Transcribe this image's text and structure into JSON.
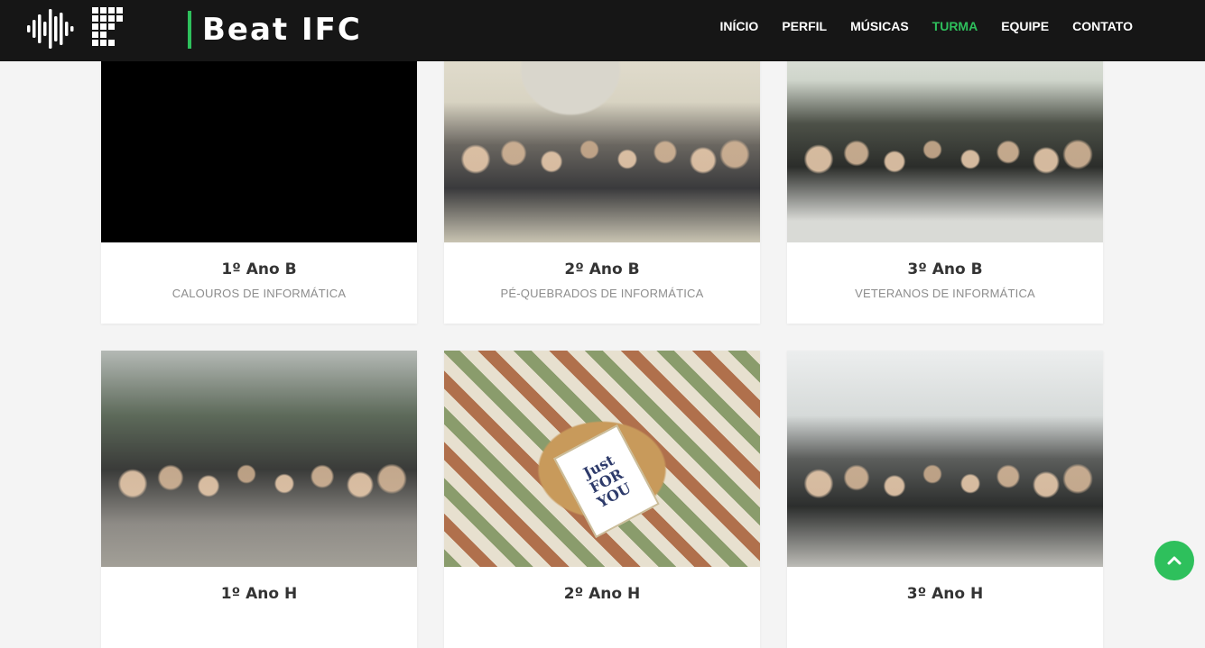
{
  "brand": {
    "name": "Beat IFC"
  },
  "icons": {
    "sound_wave": "sound-wave-icon",
    "institute_logo": "if-logo-icon",
    "scroll_top": "chevron-up-icon"
  },
  "colors": {
    "accent": "#2ec05c",
    "navbar_bg": "#161616",
    "page_bg": "#f4f4f4"
  },
  "nav": {
    "items": [
      {
        "label": "INÍCIO",
        "active": false
      },
      {
        "label": "PERFIL",
        "active": false
      },
      {
        "label": "MÚSICAS",
        "active": false
      },
      {
        "label": "TURMA",
        "active": true
      },
      {
        "label": "EQUIPE",
        "active": false
      },
      {
        "label": "CONTATO",
        "active": false
      }
    ]
  },
  "cards": [
    {
      "title": "1º Ano B",
      "subtitle": "CALOUROS DE INFORMÁTICA",
      "photo": "black"
    },
    {
      "title": "2º Ano B",
      "subtitle": "PÉ-QUEBRADOS DE INFORMÁTICA",
      "photo": "class photo"
    },
    {
      "title": "3º Ano B",
      "subtitle": "VETERANOS DE INFORMÁTICA",
      "photo": "class photo"
    },
    {
      "title": "1º Ano H",
      "subtitle": "",
      "photo": "outdoor group photo"
    },
    {
      "title": "2º Ano H",
      "subtitle": "",
      "photo": "gift box"
    },
    {
      "title": "3º Ano H",
      "subtitle": "",
      "photo": "class photo"
    }
  ],
  "gift_tag_text": "Just FOR YOU"
}
